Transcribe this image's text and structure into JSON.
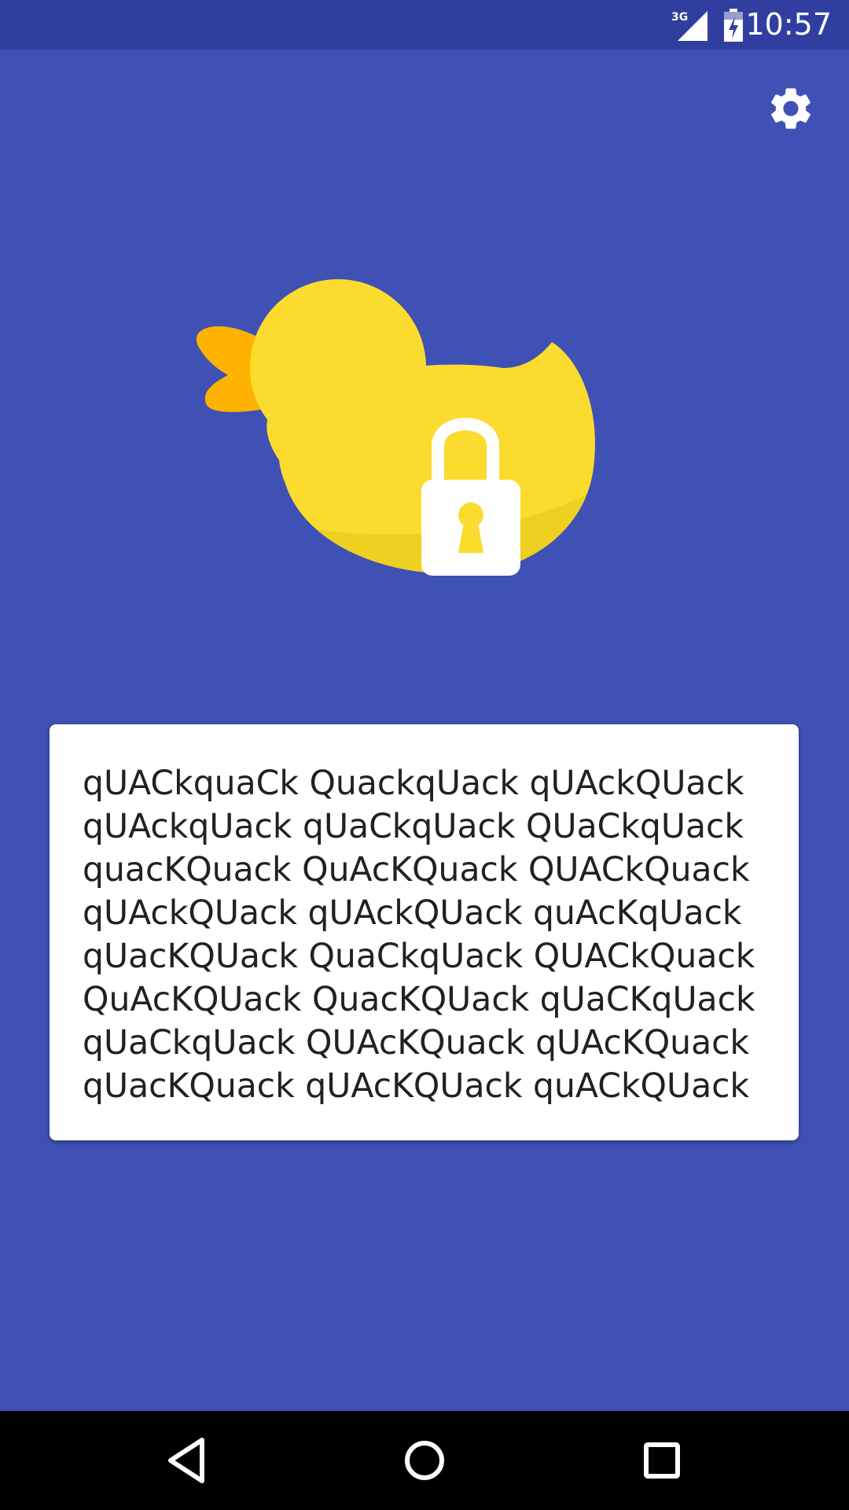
{
  "status_bar": {
    "network_type": "3G",
    "time": "10:57",
    "icons": [
      "signal-3g-icon",
      "battery-charging-icon"
    ]
  },
  "toolbar": {
    "settings_icon": "gear-icon"
  },
  "hero": {
    "image": "duck-with-padlock-illustration",
    "colors": {
      "background": "#3f51b5",
      "duck_body": "#fbdc2e",
      "duck_beak": "#ffb300",
      "lock": "#ffffff"
    }
  },
  "card": {
    "lines": [
      "qUACkquaCk QuackqUack qUAckQUack",
      "qUAckqUack qUaCkqUack QUaCkqUack",
      "quacKQuack QuAcKQuack QUACkQuack",
      "qUAckQUack qUAckQUack quAcKqUack",
      "qUacKQUack QuaCkqUack QUACkQuack",
      "QuAcKQUack QuacKQUack qUaCKqUack",
      "qUaCkqUack QUAcKQuack qUAcKQuack",
      "qUacKQuack qUAcKQUack quACkQUack"
    ]
  },
  "nav_bar": {
    "buttons": [
      "back-icon",
      "home-icon",
      "recent-apps-icon"
    ]
  }
}
